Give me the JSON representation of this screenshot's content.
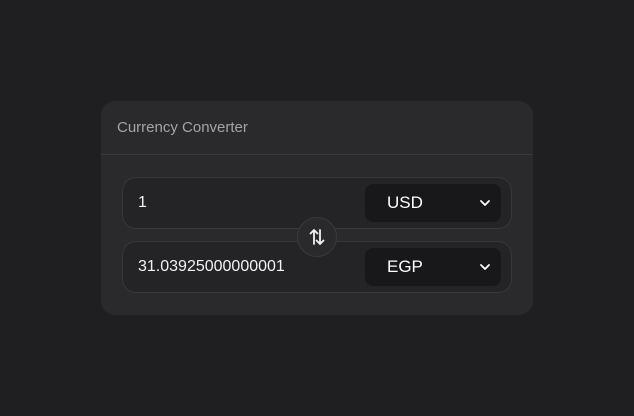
{
  "converter": {
    "title": "Currency Converter",
    "from": {
      "amount": "1",
      "currency": "USD"
    },
    "to": {
      "amount": "31.03925000000001",
      "currency": "EGP"
    },
    "swap_icon": "swap-vertical-arrows-icon"
  }
}
